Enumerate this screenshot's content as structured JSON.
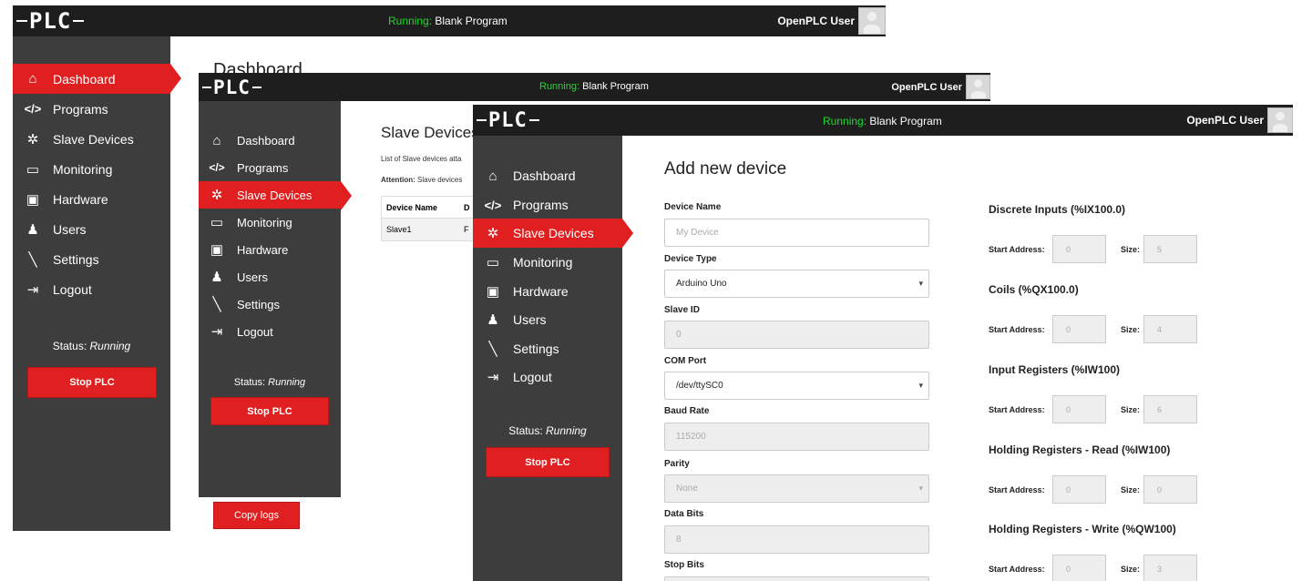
{
  "app": {
    "logo_text": "PLC",
    "run_label": "Running:",
    "program_name": "Blank Program",
    "user_name": "OpenPLC User",
    "accent_color": "#e02020",
    "running_color": "#22d82e"
  },
  "nav": [
    {
      "label": "Dashboard",
      "icon": "home-icon"
    },
    {
      "label": "Programs",
      "icon": "code-icon"
    },
    {
      "label": "Slave Devices",
      "icon": "gear-cluster-icon"
    },
    {
      "label": "Monitoring",
      "icon": "monitor-icon"
    },
    {
      "label": "Hardware",
      "icon": "chip-icon"
    },
    {
      "label": "Users",
      "icon": "users-icon"
    },
    {
      "label": "Settings",
      "icon": "wrench-icon"
    },
    {
      "label": "Logout",
      "icon": "logout-icon"
    }
  ],
  "sidebar_status": {
    "label": "Status:",
    "value": "Running",
    "stop_button": "Stop PLC"
  },
  "window1": {
    "page_title": "Dashboard"
  },
  "window2": {
    "page_title": "Slave Devices",
    "description": "List of Slave devices atta",
    "attention_label": "Attention:",
    "attention_text": "Slave devices",
    "table_headers": [
      "Device Name",
      "D"
    ],
    "table_rows": [
      [
        "Slave1",
        "F"
      ]
    ],
    "copy_logs": "Copy logs"
  },
  "window3": {
    "page_title": "Add new device",
    "fields": {
      "device_name": {
        "label": "Device Name",
        "placeholder": "My Device"
      },
      "device_type": {
        "label": "Device Type",
        "value": "Arduino Uno"
      },
      "slave_id": {
        "label": "Slave ID",
        "value": "0"
      },
      "com_port": {
        "label": "COM Port",
        "value": "/dev/ttySC0"
      },
      "baud_rate": {
        "label": "Baud Rate",
        "value": "115200"
      },
      "parity": {
        "label": "Parity",
        "value": "None"
      },
      "data_bits": {
        "label": "Data Bits",
        "value": "8"
      },
      "stop_bits": {
        "label": "Stop Bits"
      }
    },
    "start_label": "Start Address:",
    "size_label": "Size:",
    "sections": [
      {
        "title": "Discrete Inputs (%IX100.0)",
        "start": "0",
        "size": "5"
      },
      {
        "title": "Coils (%QX100.0)",
        "start": "0",
        "size": "4"
      },
      {
        "title": "Input Registers (%IW100)",
        "start": "0",
        "size": "6"
      },
      {
        "title": "Holding Registers - Read (%IW100)",
        "start": "0",
        "size": "0"
      },
      {
        "title": "Holding Registers - Write (%QW100)",
        "start": "0",
        "size": "3"
      }
    ]
  }
}
